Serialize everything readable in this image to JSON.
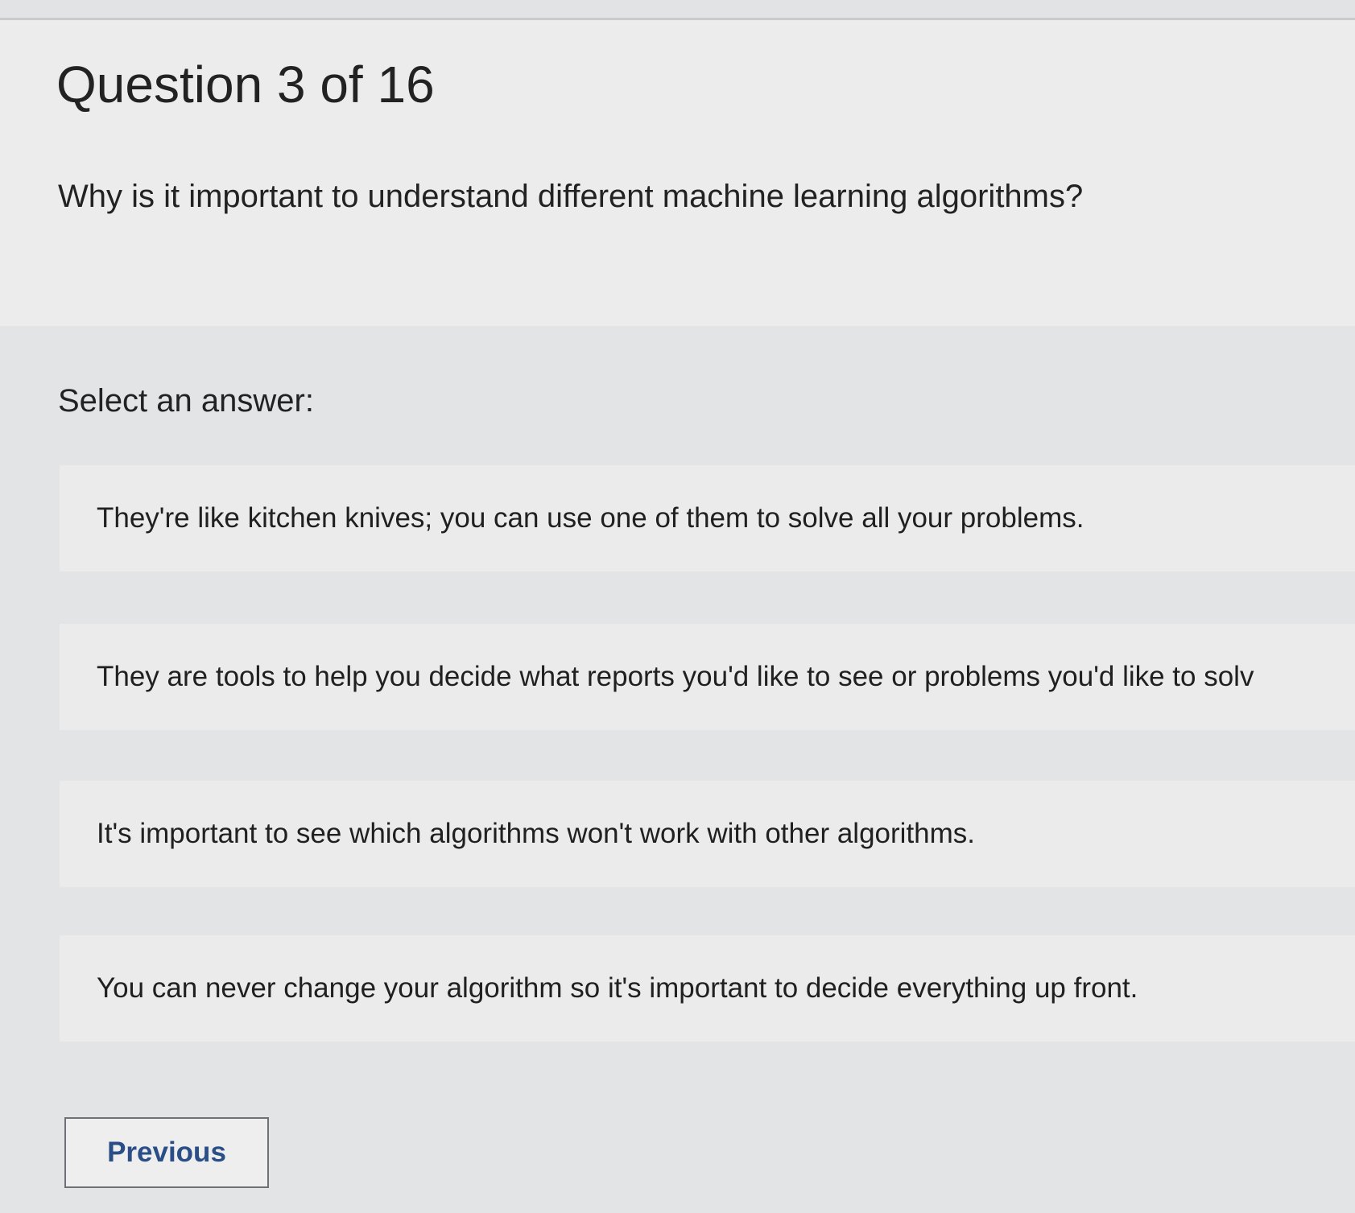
{
  "quiz": {
    "question_number": "Question 3 of 16",
    "question_text": "Why is it important to understand different machine learning algorithms?",
    "select_label": "Select an answer:",
    "options": [
      {
        "label": "They're like kitchen knives; you can use one of them to solve all your problems."
      },
      {
        "label": "They are tools to help you decide what reports you'd like to see or problems you'd like to solv"
      },
      {
        "label": "It's important to see which algorithms won't work with other algorithms."
      },
      {
        "label": "You can never change your algorithm so it's important to decide everything up front."
      }
    ],
    "previous_label": "Previous"
  },
  "colors": {
    "button_text": "#2a4f86",
    "button_border": "#6f7176",
    "option_background": "#ebebec",
    "page_background": "#e3e4e5"
  }
}
